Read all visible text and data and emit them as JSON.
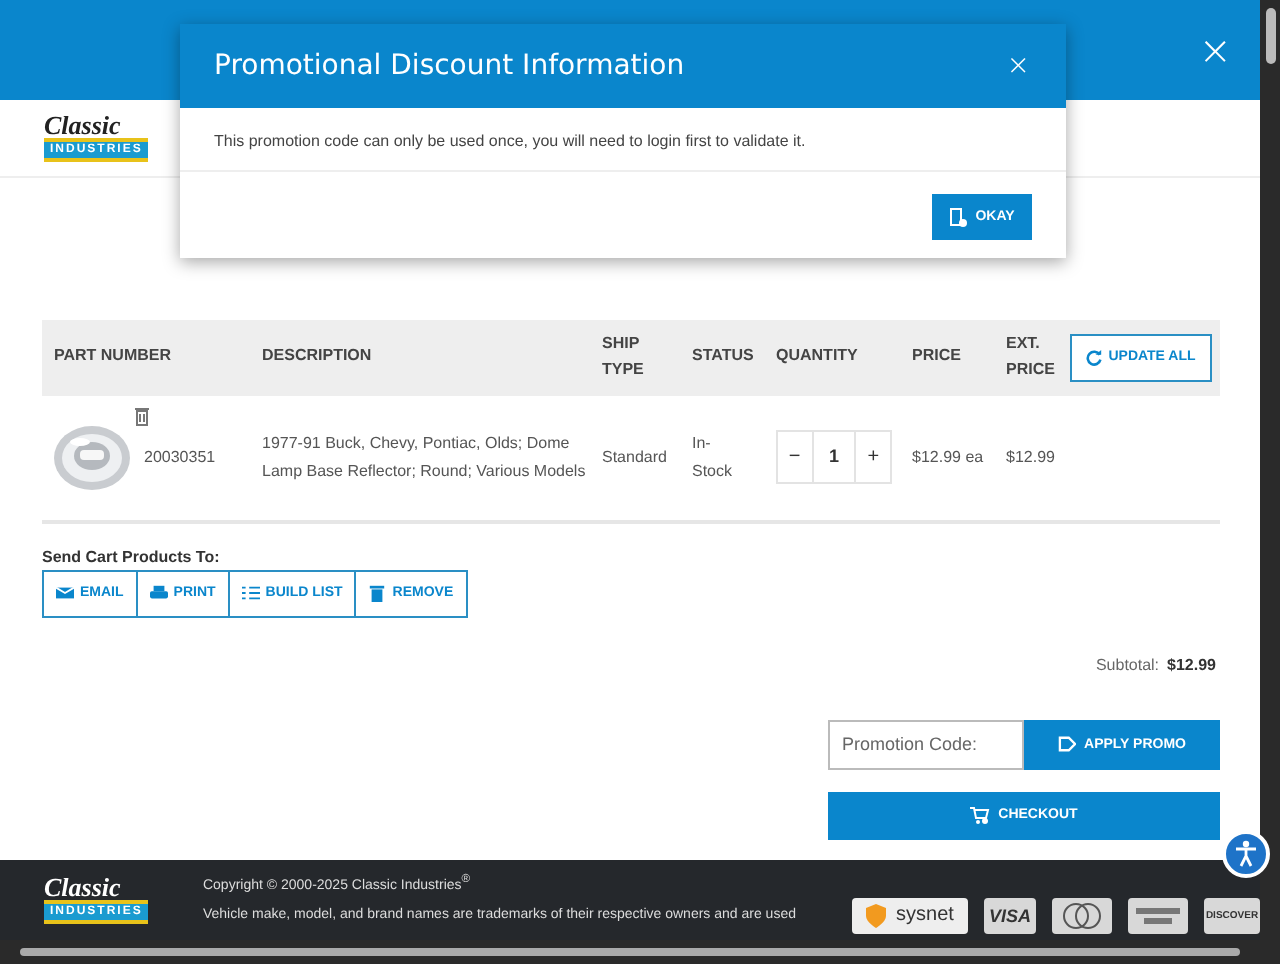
{
  "top_bar": {
    "close": "×"
  },
  "header": {
    "logo": {
      "line1": "Classic",
      "line2": "INDUSTRIES"
    }
  },
  "cart_table": {
    "columns": [
      "PART NUMBER",
      "DESCRIPTION",
      "SHIP TYPE",
      "STATUS",
      "QUANTITY",
      "PRICE",
      "EXT. PRICE"
    ],
    "update_button": "UPDATE ALL",
    "rows": [
      {
        "part_number": "20030351",
        "description": "1977-91 Buck, Chevy, Pontiac, Olds; Dome Lamp Base Reflector; Round; Various Models",
        "ship_type": "Standard",
        "status": "In-Stock",
        "decrement": "−",
        "quantity": "1",
        "increment": "+",
        "price": "$12.99 ea",
        "ext_price": "$12.99"
      }
    ]
  },
  "send_cart": {
    "label": "Send Cart Products To:",
    "buttons": [
      {
        "kind": "email",
        "label": "EMAIL"
      },
      {
        "kind": "print",
        "label": "PRINT"
      },
      {
        "kind": "build_list",
        "label": "BUILD LIST"
      },
      {
        "kind": "remove",
        "label": "REMOVE"
      }
    ]
  },
  "subtotal": {
    "label": "Subtotal:",
    "value": "$12.99"
  },
  "promo": {
    "placeholder": "Promotion Code:",
    "button": "APPLY PROMO"
  },
  "checkout": "CHECKOUT",
  "footer": {
    "logo": {
      "line1": "Classic",
      "line2": "INDUSTRIES"
    },
    "copyright": "Copyright © 2000-2025 Classic Industries$^{®}$",
    "trademark_note": "Vehicle make, model, and brand names are trademarks of their respective owners and are used",
    "badges": [
      {
        "kind": "sysnet",
        "label": "sysnet"
      },
      {
        "kind": "visa",
        "label": "VISA"
      },
      {
        "kind": "mastercard"
      },
      {
        "kind": "amex"
      },
      {
        "kind": "discover",
        "label": "DISCOVER"
      }
    ]
  },
  "modal": {
    "title": "Promotional Discount Information",
    "close": "×",
    "message": "This promotion code can only be used once, you will need to login first to validate it.",
    "button": "OKAY"
  }
}
